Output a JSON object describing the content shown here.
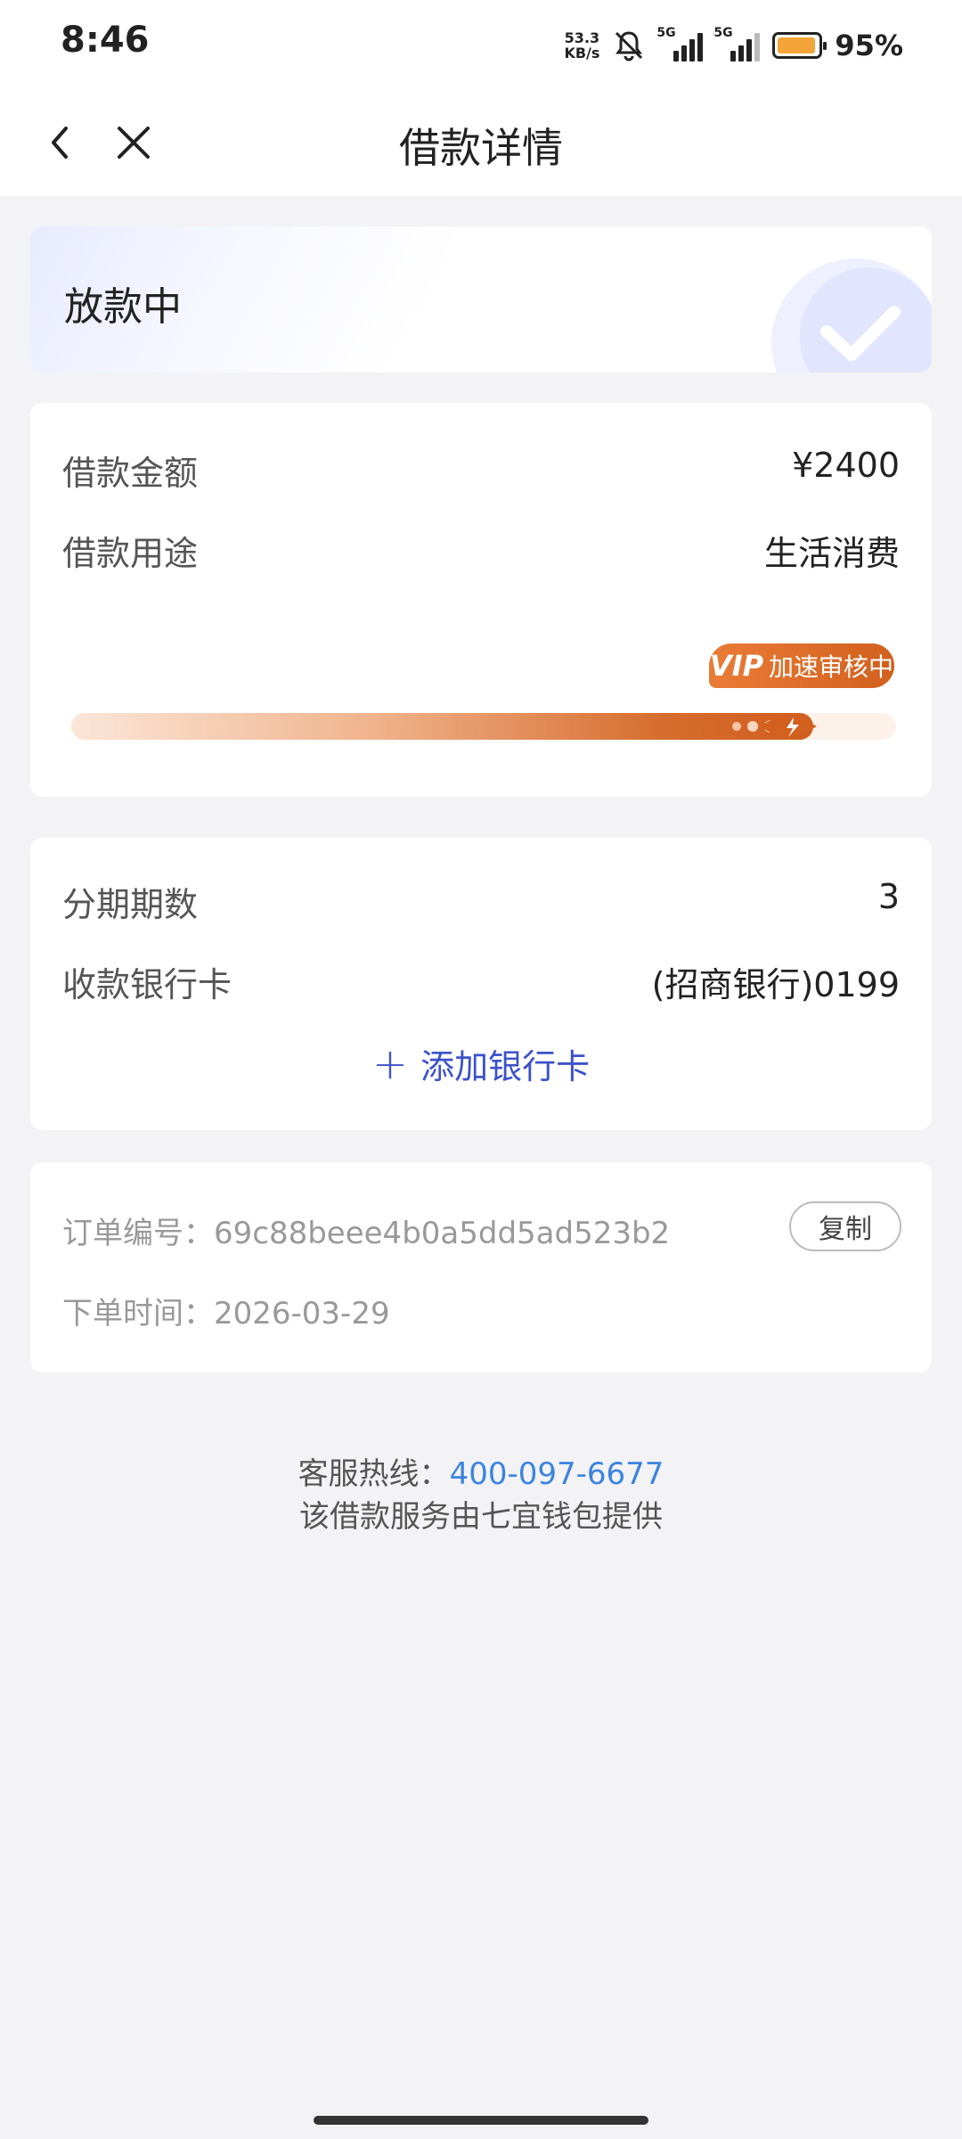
{
  "status_bar": {
    "time": "8:46",
    "net_speed_value": "53.3",
    "net_speed_unit": "KB/s",
    "sim1_tag": "5G",
    "sim2_tag": "5G",
    "battery_level": 0.95,
    "battery_text": "95%",
    "battery_color": "#f3a53a"
  },
  "nav": {
    "title": "借款详情",
    "back_icon": "chevron-left-icon",
    "close_icon": "close-icon"
  },
  "status_card": {
    "label": "放款中",
    "icon": "check-circle-icon"
  },
  "amount_card": {
    "amount_label": "借款金额",
    "amount_value": "¥2400",
    "purpose_label": "借款用途",
    "purpose_value": "生活消费",
    "progress": 0.9,
    "badge_vip": "VIP",
    "badge_text": "加速审核中",
    "accent_color": "#d2601e"
  },
  "installment_card": {
    "periods_label": "分期期数",
    "periods_value": "3",
    "bank_label": "收款银行卡",
    "bank_value": "(招商银行)0199",
    "add_card_label": "添加银行卡",
    "link_color": "#3d52c9"
  },
  "order_card": {
    "order_no_label": "订单编号：",
    "order_no_value": "69c88beee4b0a5dd5ad523b2",
    "copy_label": "复制",
    "order_time_label": "下单时间：",
    "order_time_value": "2026-03-29"
  },
  "footer": {
    "hotline_label": "客服热线：",
    "hotline_number": "400-097-6677",
    "provider_note": "该借款服务由七宜钱包提供"
  }
}
